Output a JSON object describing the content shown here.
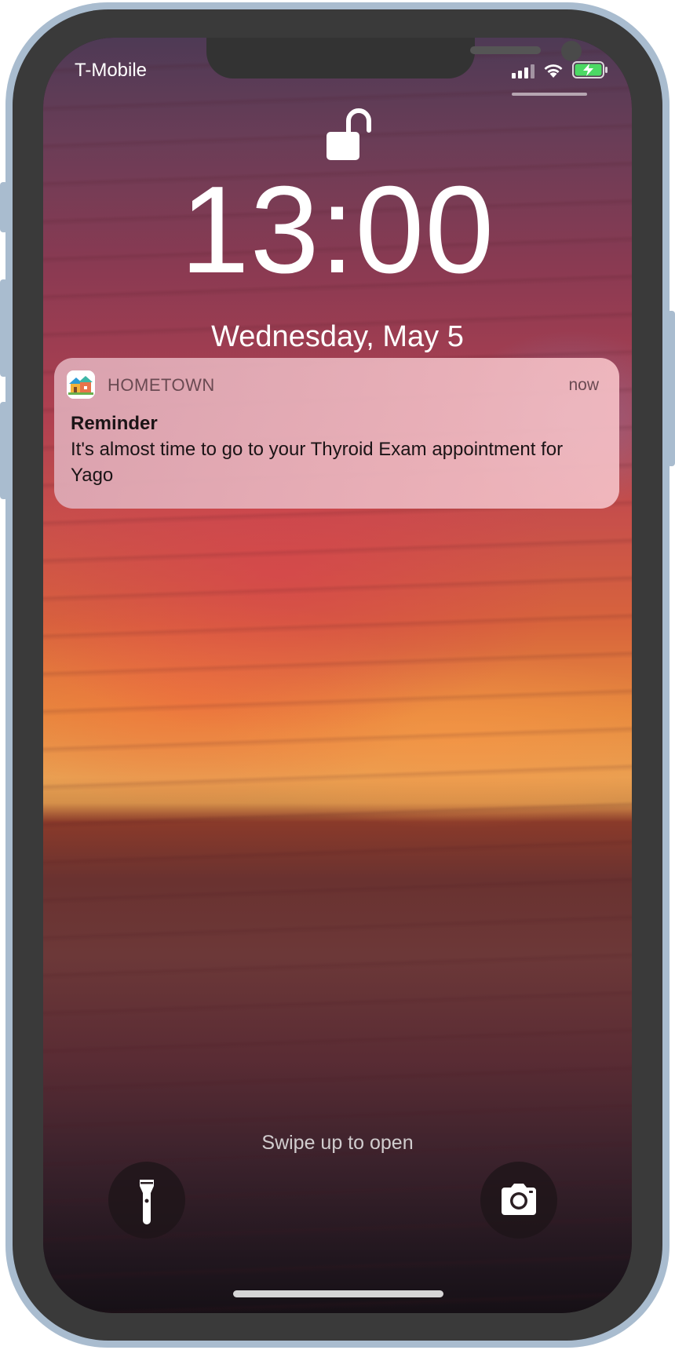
{
  "status_bar": {
    "carrier": "T-Mobile",
    "signal_icon": "cellular-signal-icon",
    "wifi_icon": "wifi-icon",
    "battery_icon": "battery-charging-icon",
    "battery_color": "#4cd964"
  },
  "lock_screen": {
    "lock_icon": "unlocked-padlock-icon",
    "time": "13:00",
    "date": "Wednesday, May 5",
    "swipe_hint": "Swipe up to open"
  },
  "notification": {
    "app_icon": "hometown-app-icon",
    "app_name": "HOMETOWN",
    "time": "now",
    "title": "Reminder",
    "body": "It's almost time to go to your Thyroid Exam appointment for Yago"
  },
  "quick_actions": {
    "left_icon": "flashlight-icon",
    "right_icon": "camera-icon"
  },
  "device": {
    "frame_color": "#a9bccf",
    "body_color": "#3a3a3a"
  }
}
